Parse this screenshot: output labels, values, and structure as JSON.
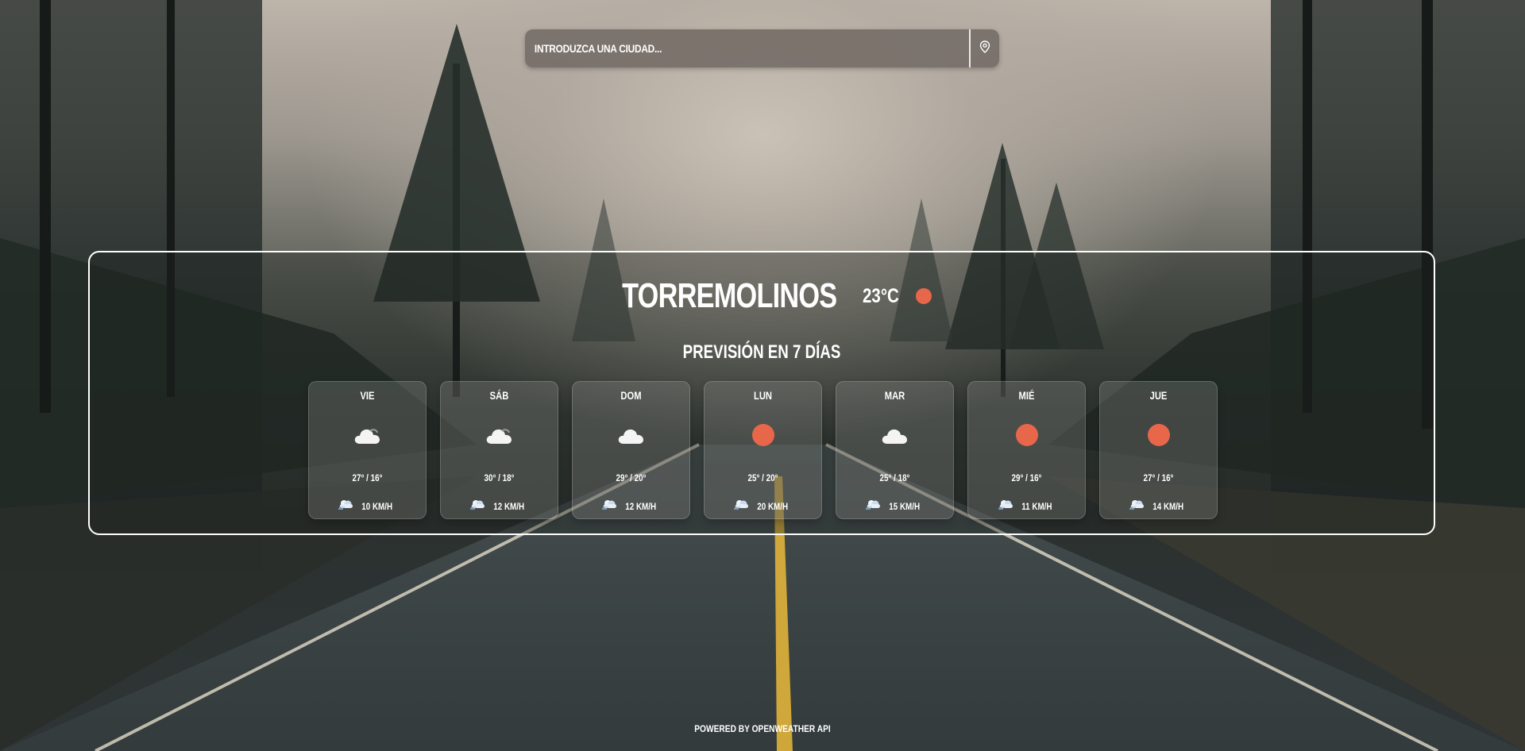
{
  "search": {
    "placeholder": "INTRODUZCA UNA CIUDAD...",
    "value": ""
  },
  "current": {
    "city": "TORREMOLINOS",
    "temperature": "23°C",
    "icon": "sun-icon"
  },
  "forecast": {
    "title": "PREVISIÓN EN 7 DÍAS",
    "days": [
      {
        "day": "VIE",
        "icon": "cloud-icon",
        "temps": "27° / 16°",
        "wind": "10 KM/H"
      },
      {
        "day": "SÁB",
        "icon": "cloud-icon",
        "temps": "30° / 18°",
        "wind": "12 KM/H"
      },
      {
        "day": "DOM",
        "icon": "cloud-icon",
        "temps": "29° / 20°",
        "wind": "12 KM/H"
      },
      {
        "day": "LUN",
        "icon": "sun-icon",
        "temps": "25° / 20°",
        "wind": "20 KM/H"
      },
      {
        "day": "MAR",
        "icon": "cloud-icon",
        "temps": "25° / 18°",
        "wind": "15 KM/H"
      },
      {
        "day": "MIÉ",
        "icon": "sun-icon",
        "temps": "29° / 16°",
        "wind": "11 KM/H"
      },
      {
        "day": "JUE",
        "icon": "sun-icon",
        "temps": "27° / 16°",
        "wind": "14 KM/H"
      }
    ]
  },
  "footer": {
    "text": "POWERED BY OPENWEATHER API"
  },
  "colors": {
    "sun": "#e8664a",
    "panel_border": "#ffffff",
    "search_bg": "#766e68"
  }
}
